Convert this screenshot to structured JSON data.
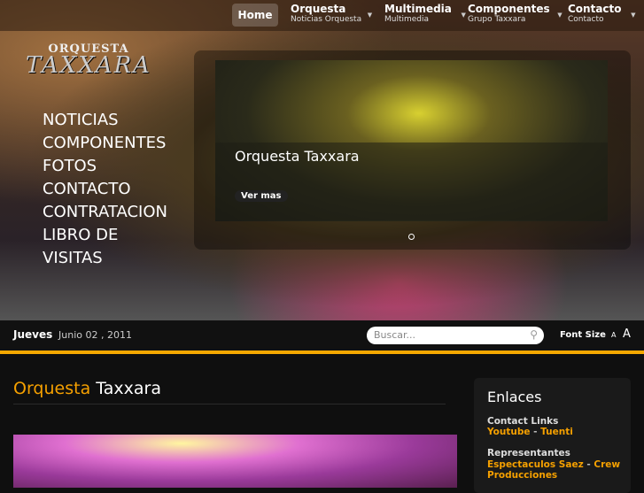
{
  "nav": {
    "home": "Home",
    "items": [
      {
        "title": "Orquesta",
        "sub": "Noticias Orquesta"
      },
      {
        "title": "Multimedia",
        "sub": "Multimedia"
      },
      {
        "title": "Componentes",
        "sub": "Grupo Taxxara"
      },
      {
        "title": "Contacto",
        "sub": "Contacto"
      }
    ]
  },
  "logo": {
    "line1": "ORQUESTA",
    "line2": "TAXXARA"
  },
  "menu": [
    "NOTICIAS",
    "COMPONENTES",
    "FOTOS",
    "CONTACTO",
    "CONTRATACION",
    "LIBRO DE",
    "VISITAS"
  ],
  "slider": {
    "title": "Orquesta Taxxara",
    "button": "Ver mas"
  },
  "bar": {
    "day": "Jueves",
    "date": "Junio 02 , 2011",
    "search_placeholder": "Buscar...",
    "font_size": "Font Size",
    "small_a": "A",
    "large_a": "A"
  },
  "article": {
    "title_accent": "Orquesta",
    "title_rest": "Taxxara"
  },
  "sidebar": {
    "title": "Enlaces",
    "contact_label": "Contact Links",
    "youtube": "Youtube",
    "sep": "-",
    "tuenti": "Tuenti",
    "rep_label": "Representantes",
    "saez": "Espectaculos Saez",
    "crew": "Crew",
    "producciones": "Producciones"
  }
}
